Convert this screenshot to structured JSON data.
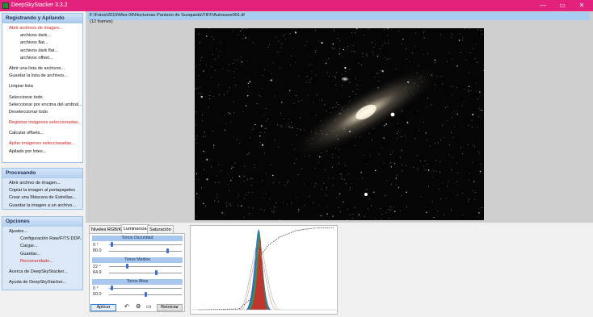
{
  "window": {
    "title": "DeepSkyStacker 3.3.2",
    "controls": [
      "—",
      "▭",
      "✕"
    ]
  },
  "sidebar": {
    "registering": {
      "header": "Registrando y Apilando",
      "items": [
        {
          "label": "Abrir archivos de imagen...",
          "style": "red",
          "indent": 0
        },
        {
          "label": "archivos dark...",
          "style": "normal",
          "indent": 2
        },
        {
          "label": "archivos flat...",
          "style": "normal",
          "indent": 2
        },
        {
          "label": "archivos dark flat...",
          "style": "normal",
          "indent": 2
        },
        {
          "label": "archivos offset...",
          "style": "normal",
          "indent": 2
        },
        {
          "label": "",
          "style": "gap",
          "indent": 0
        },
        {
          "label": "Abrir una lista de archivos...",
          "style": "normal",
          "indent": 0
        },
        {
          "label": "Guardar la lista de archivos...",
          "style": "normal",
          "indent": 0
        },
        {
          "label": "",
          "style": "gap",
          "indent": 0
        },
        {
          "label": "Limpiar lista",
          "style": "normal",
          "indent": 0
        },
        {
          "label": "",
          "style": "gap",
          "indent": 0
        },
        {
          "label": "Seleccionar todo",
          "style": "normal",
          "indent": 0
        },
        {
          "label": "Seleccionar por encima del umbral...",
          "style": "normal",
          "indent": 0
        },
        {
          "label": "Deseleccionar todo",
          "style": "normal",
          "indent": 0
        },
        {
          "label": "",
          "style": "gap",
          "indent": 0
        },
        {
          "label": "Registrar imágenes seleccionadas...",
          "style": "red",
          "indent": 0
        },
        {
          "label": "",
          "style": "gap",
          "indent": 0
        },
        {
          "label": "Calcular offsets...",
          "style": "normal",
          "indent": 0
        },
        {
          "label": "",
          "style": "gap",
          "indent": 0
        },
        {
          "label": "Apilar imágenes seleccionadas...",
          "style": "red",
          "indent": 0
        },
        {
          "label": "Apilado por lotes...",
          "style": "normal",
          "indent": 0
        }
      ]
    },
    "processing": {
      "header": "Procesando",
      "items": [
        {
          "label": "Abrir archivo de imagen...",
          "style": "normal",
          "indent": 0
        },
        {
          "label": "Copiar la imagen al portapapeles",
          "style": "normal",
          "indent": 0
        },
        {
          "label": "Crear una Máscara de Estrellas...",
          "style": "normal",
          "indent": 0
        },
        {
          "label": "Guardar la imagen a un archivo...",
          "style": "normal",
          "indent": 0
        }
      ]
    },
    "options": {
      "header": "Opciones",
      "items": [
        {
          "label": "Ajustes...",
          "style": "normal",
          "indent": 0
        },
        {
          "label": "Configuración Raw/FITS DDP...",
          "style": "normal",
          "indent": 2
        },
        {
          "label": "Cargar...",
          "style": "normal",
          "indent": 2
        },
        {
          "label": "Guardar...",
          "style": "normal",
          "indent": 2
        },
        {
          "label": "Recomendado...",
          "style": "red",
          "indent": 2
        },
        {
          "label": "",
          "style": "gap",
          "indent": 0
        },
        {
          "label": "Acerca de DeepSkyStacker...",
          "style": "normal",
          "indent": 0
        },
        {
          "label": "",
          "style": "gap",
          "indent": 0
        },
        {
          "label": "Ayuda de DeepSkyStacker...",
          "style": "normal",
          "indent": 0
        }
      ]
    }
  },
  "main": {
    "path": "F:\\Fotos\\2019\\Mes 09\\Nocturnas Pantano de Susqueda\\TIFF\\Autosave001.tif",
    "frames": "(12 frames)"
  },
  "adjust": {
    "tabs": [
      "Niveles RGB/K",
      "Luminancia",
      "Saturación"
    ],
    "active_tab": "Luminancia",
    "sections": [
      {
        "title": "Tonos Oscuridad",
        "angle": "0 °",
        "value": "80.0",
        "thumb1": 0.02,
        "thumb2": 0.82
      },
      {
        "title": "Tonos Medios",
        "angle": "22 °",
        "value": "64.9",
        "thumb1": 0.24,
        "thumb2": 0.65
      },
      {
        "title": "Tonos Altos",
        "angle": "0 °",
        "value": "50.0",
        "thumb1": 0.02,
        "thumb2": 0.5
      }
    ],
    "apply_label": "Aplicar",
    "reset_label": "Reiniciar"
  },
  "colors": {
    "titlebar": "#e2227c",
    "panel_header": "#a7c8ee",
    "path_bar": "#a6cdf2",
    "accent_red": "#d42020"
  }
}
